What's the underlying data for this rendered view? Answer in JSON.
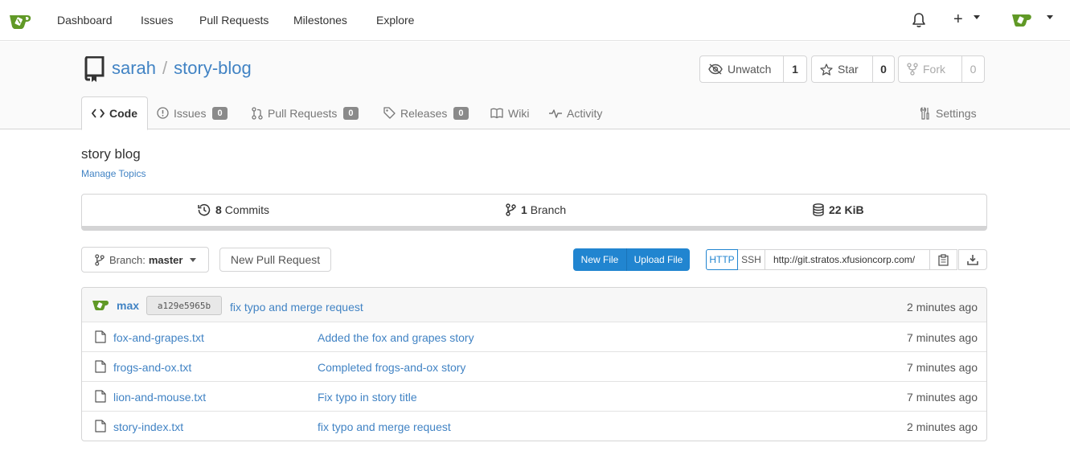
{
  "nav": {
    "items": [
      "Dashboard",
      "Issues",
      "Pull Requests",
      "Milestones",
      "Explore"
    ],
    "plus": "+"
  },
  "repo": {
    "owner": "sarah",
    "separator": "/",
    "name": "story-blog",
    "description": "story blog",
    "manage_topics": "Manage Topics"
  },
  "actions": {
    "watch": {
      "label": "Unwatch",
      "count": "1"
    },
    "star": {
      "label": "Star",
      "count": "0"
    },
    "fork": {
      "label": "Fork",
      "count": "0"
    }
  },
  "tabs": {
    "code": "Code",
    "issues": {
      "label": "Issues",
      "count": "0"
    },
    "pulls": {
      "label": "Pull Requests",
      "count": "0"
    },
    "releases": {
      "label": "Releases",
      "count": "0"
    },
    "wiki": "Wiki",
    "activity": "Activity",
    "settings": "Settings"
  },
  "stats": {
    "commits": {
      "value": "8",
      "label": "Commits"
    },
    "branches": {
      "value": "1",
      "label": "Branch"
    },
    "size": {
      "value": "22 KiB"
    }
  },
  "controls": {
    "branch_prefix": "Branch:",
    "branch_name": "master",
    "new_pull_request": "New Pull Request",
    "new_file": "New File",
    "upload_file": "Upload File",
    "http": "HTTP",
    "ssh": "SSH",
    "clone_url": "http://git.stratos.xfusioncorp.com/"
  },
  "latest_commit": {
    "author": "max",
    "sha": "a129e5965b",
    "message": "fix typo and merge request",
    "time": "2 minutes ago"
  },
  "files": [
    {
      "name": "fox-and-grapes.txt",
      "message": "Added the fox and grapes story",
      "time": "7 minutes ago"
    },
    {
      "name": "frogs-and-ox.txt",
      "message": "Completed frogs-and-ox story",
      "time": "7 minutes ago"
    },
    {
      "name": "lion-and-mouse.txt",
      "message": "Fix typo in story title",
      "time": "7 minutes ago"
    },
    {
      "name": "story-index.txt",
      "message": "fix typo and merge request",
      "time": "2 minutes ago"
    }
  ],
  "colors": {
    "link": "#4183c4",
    "primary_button": "#2185d0",
    "brand_green": "#609926"
  }
}
